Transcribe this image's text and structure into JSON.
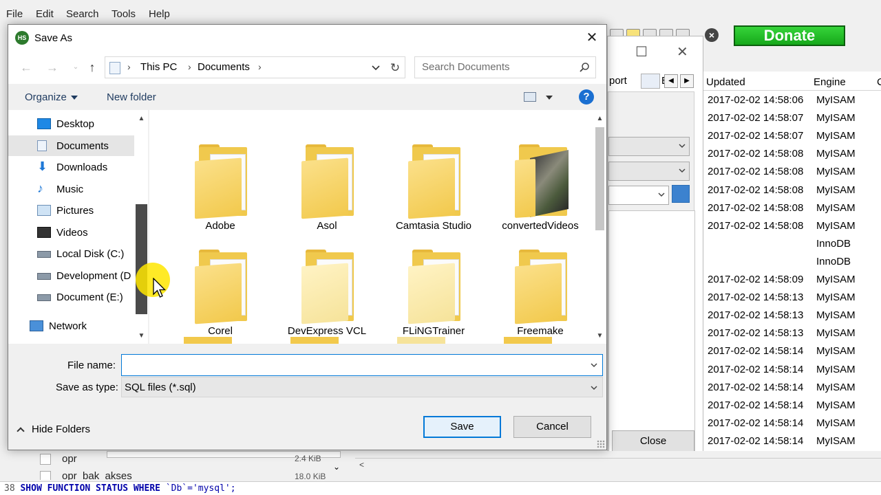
{
  "app": {
    "menu": [
      "File",
      "Edit",
      "Search",
      "Tools",
      "Help"
    ],
    "donate_label": "Donate",
    "bg_dialog": {
      "tab_text": "port",
      "tab_partial": "E",
      "close_label": "Close"
    },
    "grid": {
      "headers": [
        "Updated",
        "Engine",
        "C"
      ],
      "rows": [
        {
          "updated": "2017-02-02 14:58:06",
          "engine": "MyISAM"
        },
        {
          "updated": "2017-02-02 14:58:07",
          "engine": "MyISAM"
        },
        {
          "updated": "2017-02-02 14:58:07",
          "engine": "MyISAM"
        },
        {
          "updated": "2017-02-02 14:58:08",
          "engine": "MyISAM"
        },
        {
          "updated": "2017-02-02 14:58:08",
          "engine": "MyISAM"
        },
        {
          "updated": "2017-02-02 14:58:08",
          "engine": "MyISAM"
        },
        {
          "updated": "2017-02-02 14:58:08",
          "engine": "MyISAM"
        },
        {
          "updated": "2017-02-02 14:58:08",
          "engine": "MyISAM"
        },
        {
          "updated": "",
          "engine": "InnoDB"
        },
        {
          "updated": "",
          "engine": "InnoDB"
        },
        {
          "updated": "2017-02-02 14:58:09",
          "engine": "MyISAM"
        },
        {
          "updated": "2017-02-02 14:58:13",
          "engine": "MyISAM"
        },
        {
          "updated": "2017-02-02 14:58:13",
          "engine": "MyISAM"
        },
        {
          "updated": "2017-02-02 14:58:13",
          "engine": "MyISAM"
        },
        {
          "updated": "2017-02-02 14:58:14",
          "engine": "MyISAM"
        },
        {
          "updated": "2017-02-02 14:58:14",
          "engine": "MyISAM"
        },
        {
          "updated": "2017-02-02 14:58:14",
          "engine": "MyISAM"
        },
        {
          "updated": "2017-02-02 14:58:14",
          "engine": "MyISAM"
        },
        {
          "updated": "2017-02-02 14:58:14",
          "engine": "MyISAM"
        },
        {
          "updated": "2017-02-02 14:58:14",
          "engine": "MyISAM"
        }
      ]
    },
    "tree": [
      {
        "label": "opr",
        "size": "2.4 KiB"
      },
      {
        "label": "opr_bak_akses",
        "size": "18.0 KiB"
      }
    ],
    "sql": {
      "line_no": "38",
      "keywords": "SHOW FUNCTION STATUS WHERE",
      "rest": "`Db`='mysql';"
    }
  },
  "dialog": {
    "title": "Save As",
    "close_glyph": "✕",
    "address": {
      "parts": [
        "This PC",
        "Documents"
      ]
    },
    "search_placeholder": "Search Documents",
    "organize_label": "Organize",
    "new_folder_label": "New folder",
    "help_glyph": "?",
    "nav_items": [
      {
        "label": "Desktop",
        "icon": "desktop-icon",
        "indent": 1,
        "selected": false
      },
      {
        "label": "Documents",
        "icon": "documents-icon",
        "indent": 1,
        "selected": true
      },
      {
        "label": "Downloads",
        "icon": "downloads-icon",
        "indent": 1,
        "selected": false
      },
      {
        "label": "Music",
        "icon": "music-icon",
        "indent": 1,
        "selected": false
      },
      {
        "label": "Pictures",
        "icon": "pictures-icon",
        "indent": 1,
        "selected": false
      },
      {
        "label": "Videos",
        "icon": "videos-icon",
        "indent": 1,
        "selected": false
      },
      {
        "label": "Local Disk (C:)",
        "icon": "drive-icon",
        "indent": 1,
        "selected": false
      },
      {
        "label": "Development (D",
        "icon": "drive-icon",
        "indent": 1,
        "selected": false
      },
      {
        "label": "Document (E:)",
        "icon": "drive-icon",
        "indent": 1,
        "selected": false
      },
      {
        "label": "Network",
        "icon": "network-icon",
        "indent": 0,
        "selected": false
      }
    ],
    "folders": [
      {
        "label": "Adobe",
        "style": "normal"
      },
      {
        "label": "Asol",
        "style": "normal"
      },
      {
        "label": "Camtasia Studio",
        "style": "normal"
      },
      {
        "label": "convertedVideos",
        "style": "photo"
      },
      {
        "label": "Corel",
        "style": "normal"
      },
      {
        "label": "DevExpress VCL",
        "style": "plain"
      },
      {
        "label": "FLiNGTrainer",
        "style": "plain"
      },
      {
        "label": "Freemake",
        "style": "normal"
      }
    ],
    "file_name_label": "File name:",
    "file_name_value": "",
    "save_type_label": "Save as type:",
    "save_type_value": "SQL files (*.sql)",
    "hide_folders_label": "Hide Folders",
    "save_label": "Save",
    "cancel_label": "Cancel"
  },
  "colors": {
    "accent": "#0078d7",
    "donate_green": "#16a81a",
    "folder_yellow": "#f2c94c"
  }
}
